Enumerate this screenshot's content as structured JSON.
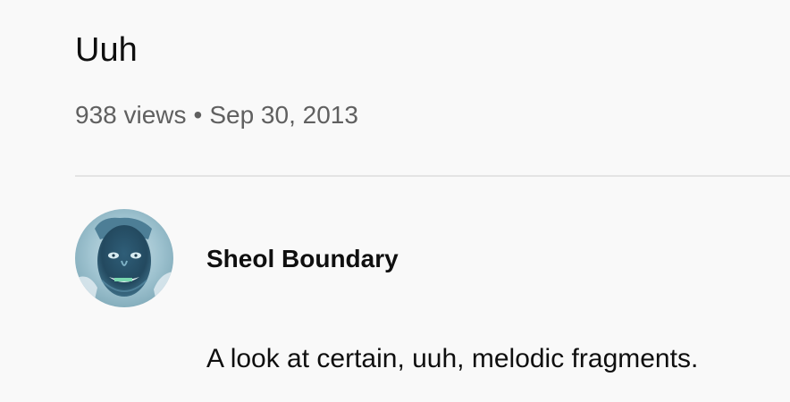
{
  "video": {
    "title": "Uuh",
    "views": "938 views",
    "separator": "•",
    "date": "Sep 30, 2013",
    "description": "A look at certain, uuh, melodic fragments."
  },
  "channel": {
    "name": "Sheol Boundary",
    "avatar_icon": "channel-avatar-image"
  }
}
